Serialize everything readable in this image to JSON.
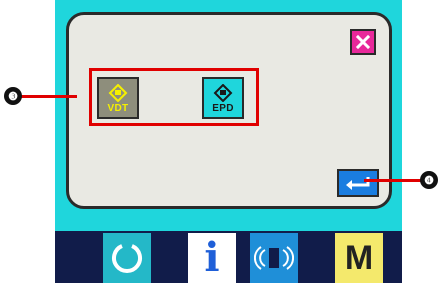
{
  "colors": {
    "screen_bg": "#1fd6dc",
    "panel_bg": "#e9e9e3",
    "close": "#e8289a",
    "selection_frame": "#e00000",
    "enter": "#1a7de0",
    "bar": "#111c4a"
  },
  "dialog": {
    "close_icon": "close-icon",
    "enter_icon": "enter-icon"
  },
  "modes": [
    {
      "label": "VDT",
      "icon": "vdt-icon",
      "selected": true
    },
    {
      "label": "EPD",
      "icon": "epd-icon",
      "selected": false
    }
  ],
  "callouts": {
    "selection": "❸",
    "enter": "❹"
  },
  "bottom_bar": {
    "reset_icon": "reset-icon",
    "info_label": "i",
    "comm_icon": "communication-icon",
    "mode_label": "M"
  }
}
